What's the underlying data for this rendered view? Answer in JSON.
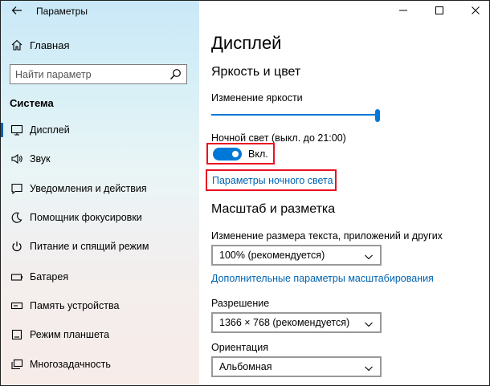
{
  "window": {
    "title": "Параметры"
  },
  "sidebar": {
    "home_label": "Главная",
    "search_placeholder": "Найти параметр",
    "section_label": "Система",
    "items": [
      {
        "label": "Дисплей",
        "icon": "monitor-icon",
        "active": true
      },
      {
        "label": "Звук",
        "icon": "speaker-icon",
        "active": false
      },
      {
        "label": "Уведомления и действия",
        "icon": "notification-icon",
        "active": false
      },
      {
        "label": "Помощник фокусировки",
        "icon": "moon-icon",
        "active": false
      },
      {
        "label": "Питание и спящий режим",
        "icon": "power-icon",
        "active": false
      },
      {
        "label": "Батарея",
        "icon": "battery-icon",
        "active": false
      },
      {
        "label": "Память устройства",
        "icon": "storage-icon",
        "active": false
      },
      {
        "label": "Режим планшета",
        "icon": "tablet-icon",
        "active": false
      },
      {
        "label": "Многозадачность",
        "icon": "multitask-icon",
        "active": false
      }
    ]
  },
  "main": {
    "page_title": "Дисплей",
    "brightness_section": "Яркость и цвет",
    "brightness_label": "Изменение яркости",
    "brightness_value": 1.0,
    "night_light_label": "Ночной свет (выкл. до 21:00)",
    "night_light_toggle_state": "Вкл.",
    "night_light_on": true,
    "night_light_settings_link": "Параметры ночного света",
    "scale_section": "Масштаб и разметка",
    "scale_label": "Изменение размера текста, приложений и других элементов",
    "scale_value": "100% (рекомендуется)",
    "advanced_scaling_link": "Дополнительные параметры масштабирования",
    "resolution_label": "Разрешение",
    "resolution_value": "1366 × 768 (рекомендуется)",
    "orientation_label": "Ориентация",
    "orientation_value": "Альбомная"
  },
  "colors": {
    "accent": "#0078d7",
    "link": "#0063b1",
    "highlight_box": "#e81123"
  }
}
